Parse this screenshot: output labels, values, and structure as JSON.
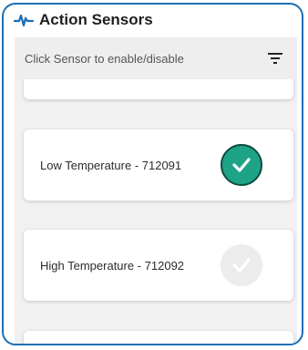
{
  "header": {
    "title": "Action Sensors",
    "icon": "pulse-icon",
    "accent": "#1a6fb5"
  },
  "toolbar": {
    "hint": "Click Sensor to enable/disable",
    "filter_icon": "filter-icon"
  },
  "sensors": [
    {
      "label": "Low Temperature - 712091",
      "enabled": true,
      "check_color": "#1fa387"
    },
    {
      "label": "High Temperature - 712092",
      "enabled": false,
      "check_color": "#ececec"
    }
  ]
}
